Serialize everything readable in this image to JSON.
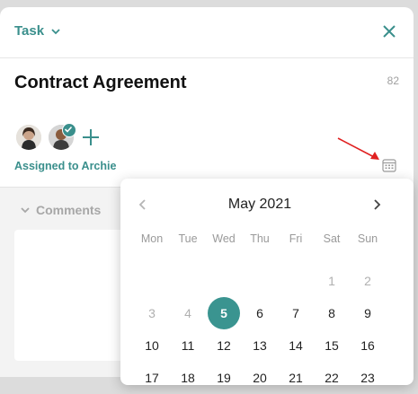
{
  "header": {
    "task_type": "Task",
    "close_icon": "close-icon"
  },
  "task": {
    "title": "Contract Agreement",
    "char_count": "82",
    "assigned_text": "Assigned to Archie"
  },
  "comments": {
    "label": "Comments"
  },
  "calendar": {
    "month_label": "May 2021",
    "weekdays": [
      "Mon",
      "Tue",
      "Wed",
      "Thu",
      "Fri",
      "Sat",
      "Sun"
    ],
    "rows": [
      [
        "",
        "",
        "",
        "",
        "",
        "1",
        "2"
      ],
      [
        "3",
        "4",
        "5",
        "6",
        "7",
        "8",
        "9"
      ],
      [
        "10",
        "11",
        "12",
        "13",
        "14",
        "15",
        "16"
      ],
      [
        "17",
        "18",
        "19",
        "20",
        "21",
        "22",
        "23"
      ]
    ],
    "selected_day": "5",
    "muted_days": [
      "1",
      "2",
      "3",
      "4"
    ]
  },
  "colors": {
    "accent": "#3a8f8c",
    "selected": "#3a9490",
    "arrow": "#e02020"
  }
}
